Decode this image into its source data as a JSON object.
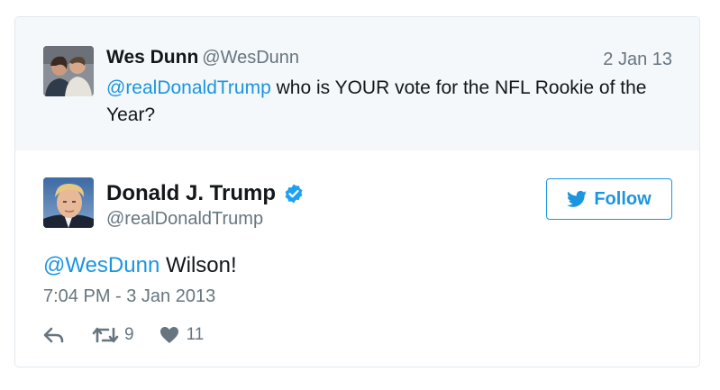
{
  "parent_tweet": {
    "name": "Wes Dunn",
    "handle": "@WesDunn",
    "date": "2 Jan 13",
    "mention": "@realDonaldTrump",
    "text": " who is YOUR vote for the NFL Rookie of the Year?"
  },
  "main_tweet": {
    "name": "Donald J. Trump",
    "handle": "@realDonaldTrump",
    "mention": "@WesDunn",
    "text": " Wilson!",
    "timestamp": "7:04 PM - 3 Jan 2013",
    "retweet_count": "9",
    "like_count": "11",
    "verified_icon": "verified-badge-icon"
  },
  "follow_button": {
    "label": "Follow",
    "icon": "twitter-bird-icon"
  },
  "colors": {
    "link": "#1b95e0",
    "secondary_text": "#66757f",
    "parent_background": "#f5f8fa",
    "border": "#e1e8ed"
  }
}
